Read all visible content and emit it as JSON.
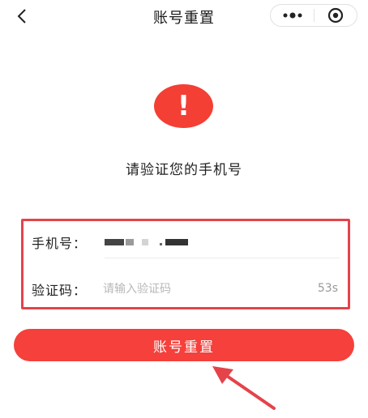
{
  "nav": {
    "title": "账号重置",
    "back_icon": "chevron-left-icon",
    "more_icon": "more-dots-icon",
    "close_icon": "target-circle-icon"
  },
  "alert": {
    "mark": "!",
    "color": "#f43f35"
  },
  "heading": "请验证您的手机号",
  "form": {
    "phone_label": "手机号：",
    "phone_value_masked": "■■■ ■ .■■■",
    "code_label": "验证码：",
    "code_value": "",
    "code_placeholder": "请输入验证码",
    "countdown": "53s",
    "highlight_color": "#e5434a"
  },
  "submit": {
    "label": "账号重置",
    "color": "#f5403b"
  },
  "annotation": {
    "arrow_color": "#e5434a"
  }
}
